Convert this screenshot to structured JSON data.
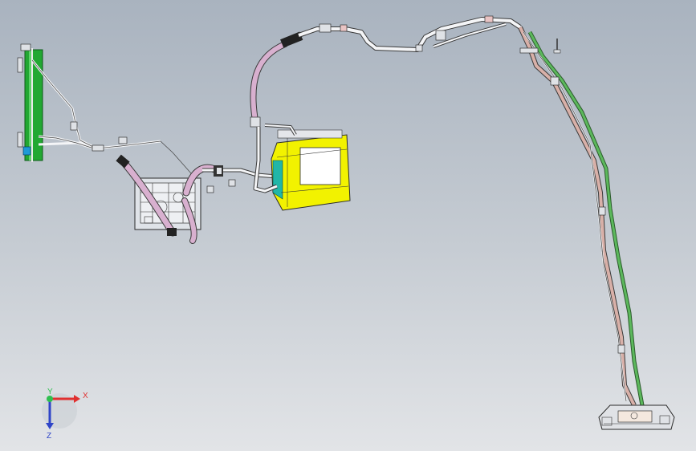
{
  "viewport": {
    "background_top": "#a9b3bf",
    "background_bottom": "#e2e4e7"
  },
  "model": {
    "components": [
      {
        "id": "condenser",
        "name": "condenser-icon",
        "color": "#22a832"
      },
      {
        "id": "compressor",
        "name": "compressor-icon",
        "color": "#d9dde2"
      },
      {
        "id": "hvac_unit",
        "name": "hvac-unit-icon",
        "color": "#f2f200"
      },
      {
        "id": "rear_evaporator",
        "name": "rear-evaporator-icon",
        "color": "#e0e2e6"
      }
    ],
    "hoses": {
      "suction_color": "#d8b0cf",
      "liquid_line_color": "#d8b0a8",
      "green_line_color": "#5cb85c",
      "metal_line_color": "#f3f4f6"
    }
  },
  "triad": {
    "x_label": "X",
    "y_label": "Y",
    "z_label": "Z",
    "x_color": "#e03030",
    "y_color": "#2fbf4f",
    "z_color": "#2f45c8"
  }
}
